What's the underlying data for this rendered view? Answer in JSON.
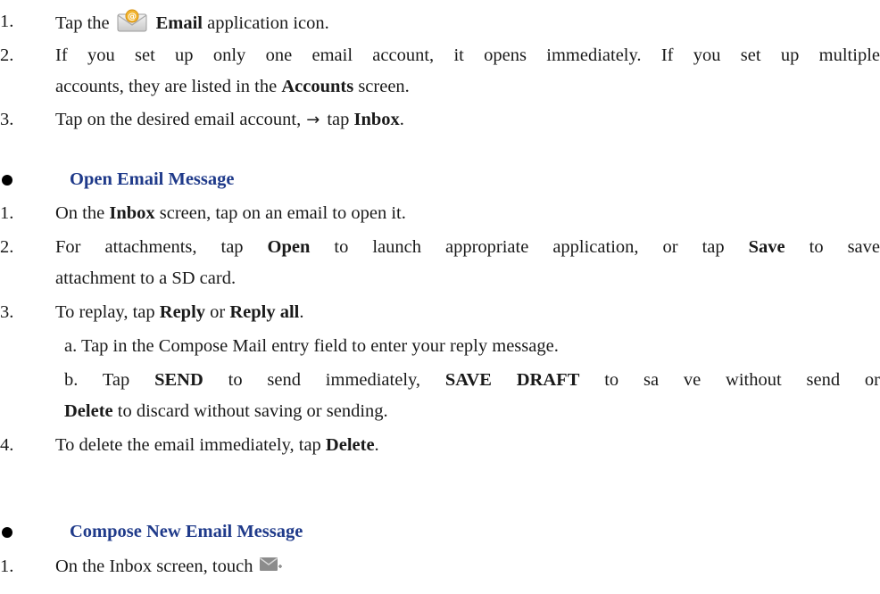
{
  "steps_top": [
    {
      "num": "1.",
      "pre": "Tap the",
      "bold": "Email",
      "post": "application icon."
    },
    {
      "num": "2.",
      "line1": "If you set up only one email account, it opens immediately. If you set up multiple",
      "line2_pre": "accounts, they are listed in the",
      "line2_bold": "Accounts",
      "line2_post": "screen."
    },
    {
      "num": "3.",
      "pre": "Tap on the desired email account,",
      "arrow": "→",
      "mid": "tap",
      "bold": "Inbox",
      "post": "."
    }
  ],
  "section_open": {
    "title": "Open Email Message",
    "steps": [
      {
        "num": "1.",
        "pre": "On the",
        "bold": "Inbox",
        "post": "screen, tap on an email to open it."
      },
      {
        "num": "2.",
        "p1": "For attachments, tap",
        "b1": "Open",
        "p2": "to launch appropriate application, or tap",
        "b2": "Save",
        "p3": "to save",
        "line2": "attachment to a SD card."
      },
      {
        "num": "3.",
        "pre": "To replay, tap",
        "b1": "Reply",
        "mid": "or",
        "b2": "Reply all",
        "post": ".",
        "sub_a": "a. Tap in the Compose Mail entry field to enter your reply message.",
        "sub_b": {
          "p1": "b. Tap",
          "b1": "SEND",
          "p2": "to send immediately,",
          "b2": "SAVE DRAFT",
          "p3": "to sa ve without send or",
          "b3": "Delete",
          "p4": "to discard without saving or sending."
        }
      },
      {
        "num": "4.",
        "pre": "To delete the email immediately, tap",
        "bold": "Delete",
        "post": "."
      }
    ]
  },
  "section_compose": {
    "title": "Compose New Email Message",
    "steps": [
      {
        "num": "1.",
        "pre": "On the Inbox screen, touch"
      }
    ]
  },
  "icons": {
    "email": "email-app-icon",
    "compose": "compose-mail-icon"
  },
  "colors": {
    "heading": "#1f3a8a",
    "text": "#1a1a1a"
  }
}
